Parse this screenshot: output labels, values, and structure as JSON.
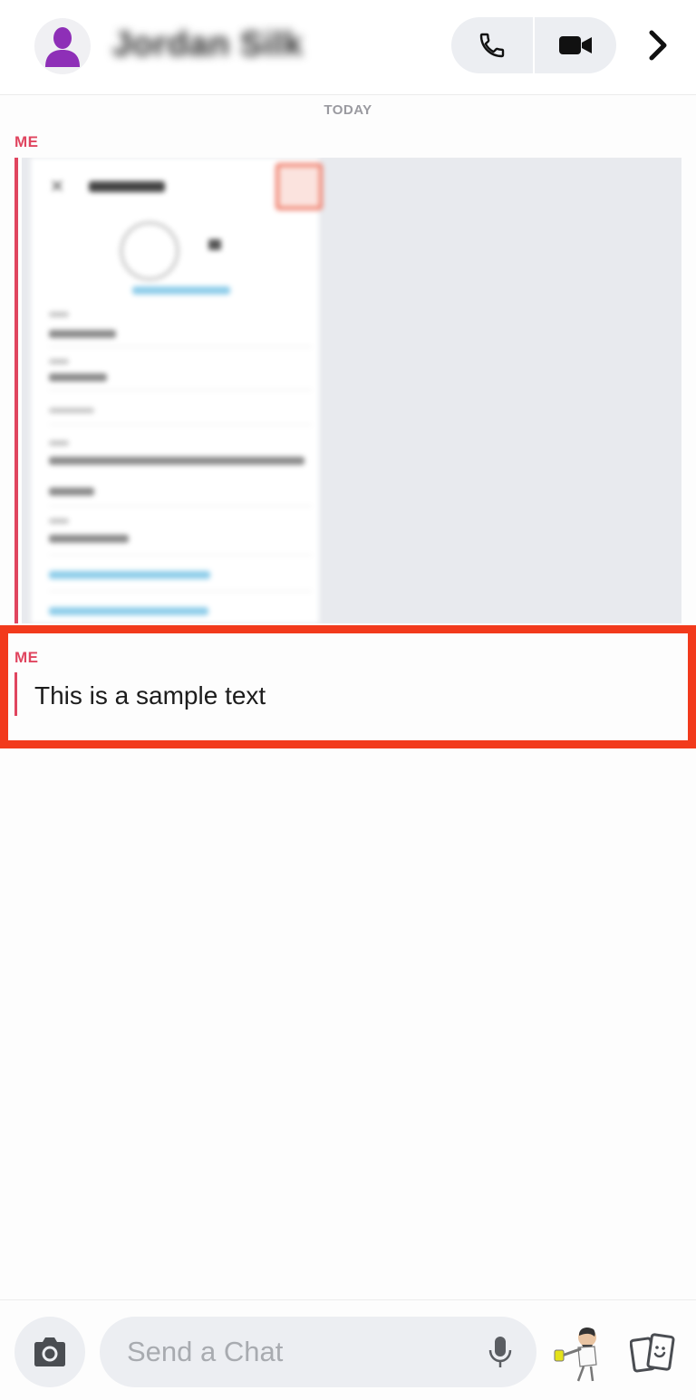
{
  "header": {
    "contact_name": "Jordan Silk",
    "avatar_icon": "person-silhouette-icon",
    "avatar_color": "#8e2fb7",
    "buttons": [
      "phone-icon",
      "video-camera-icon",
      "chevron-right-icon"
    ]
  },
  "chat": {
    "date_label": "TODAY",
    "messages": [
      {
        "sender": "ME",
        "type": "image"
      },
      {
        "sender": "ME",
        "type": "text",
        "text": "This is a sample text"
      }
    ],
    "accent_color": "#e0455f",
    "highlight_color": "#f23a1c"
  },
  "composer": {
    "placeholder": "Send a Chat",
    "icons": [
      "camera-icon",
      "microphone-icon",
      "bitmoji-icon",
      "cards-icon"
    ]
  }
}
